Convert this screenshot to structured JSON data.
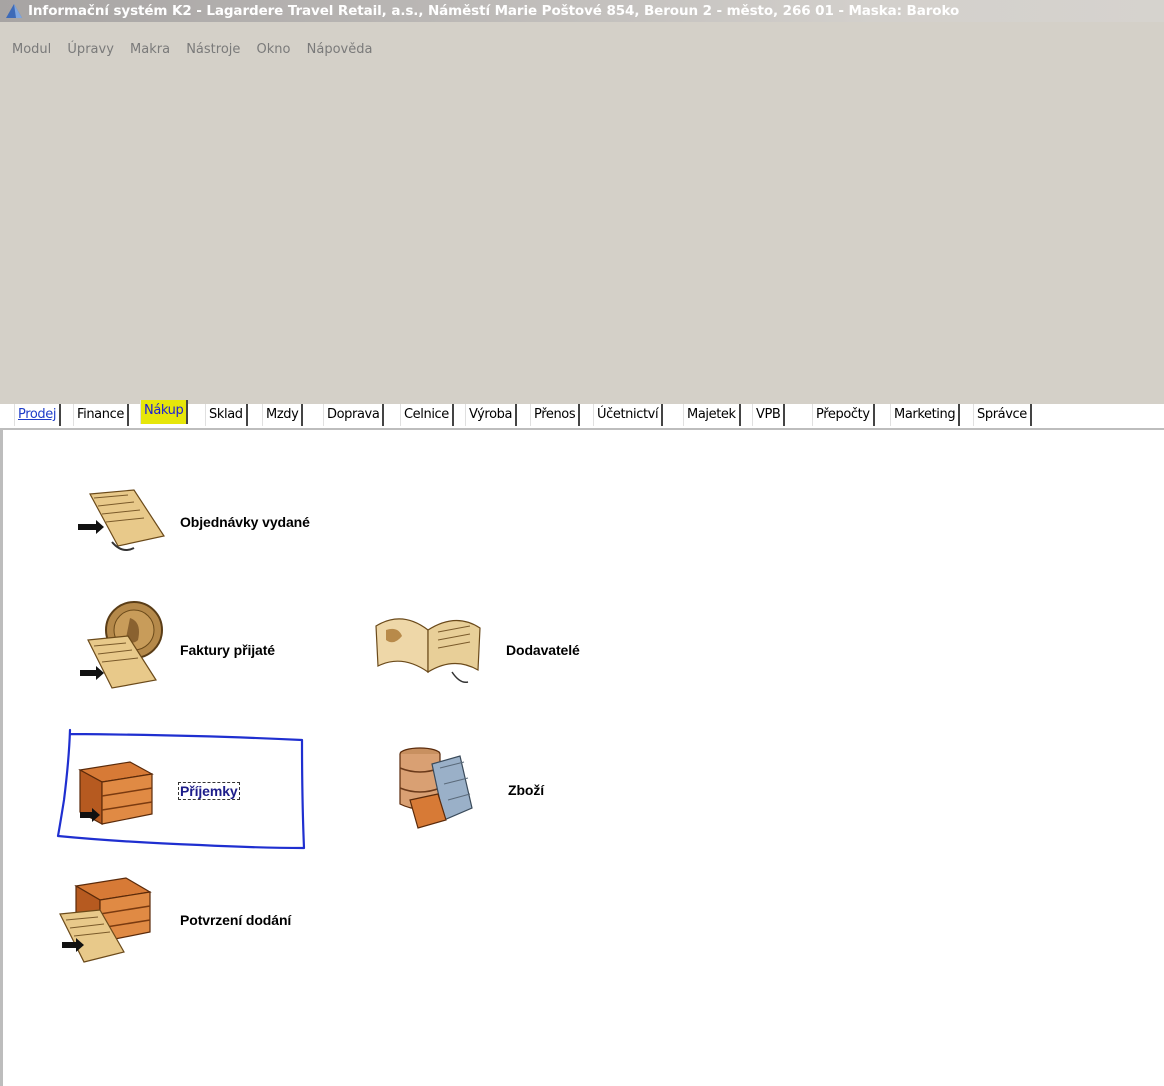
{
  "window": {
    "title": "Informační systém K2 - Lagardere Travel Retail, a.s., Náměstí Marie Poštové 854, Beroun 2 - město, 266 01 -  Maska: Baroko"
  },
  "menu": [
    "Modul",
    "Úpravy",
    "Makra",
    "Nástroje",
    "Okno",
    "Nápověda"
  ],
  "tabs": [
    "Prodej",
    "Finance",
    "Nákup",
    "Sklad",
    "Mzdy",
    "Doprava",
    "Celnice",
    "Výroba",
    "Přenos",
    "Účetnictví",
    "Majetek",
    "VPB",
    "Přepočty",
    "Marketing",
    "Správce"
  ],
  "active_tab": "Nákup",
  "modules": {
    "objednavky": "Objednávky vydané",
    "faktury": "Faktury přijaté",
    "dodavatele": "Dodavatelé",
    "prijemky": "Příjemky",
    "zbozi": "Zboží",
    "potvrzeni": "Potvrzení dodání"
  },
  "colors": {
    "highlight": "#e6e60a",
    "annotation": "#1f2fd0"
  }
}
